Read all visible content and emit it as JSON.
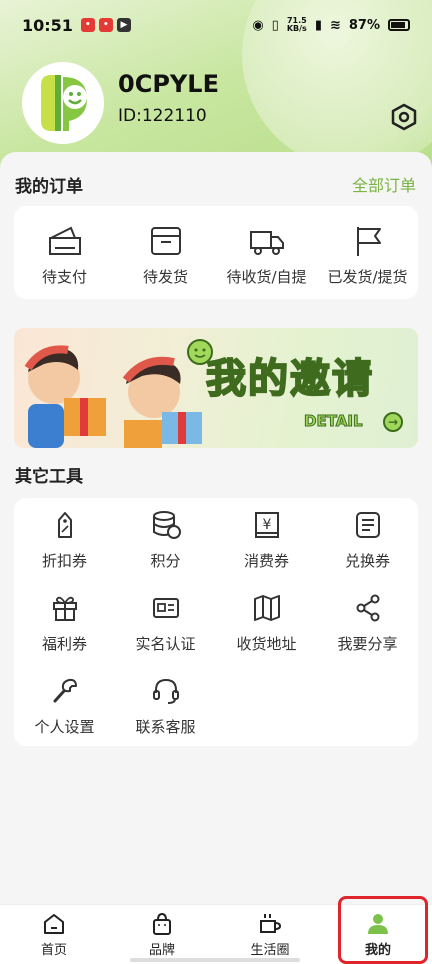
{
  "status_bar": {
    "time": "10:51",
    "net_speed_value": "71.5",
    "net_speed_unit": "KB/s",
    "battery": "87%"
  },
  "profile": {
    "username": "0CPYLE",
    "user_id": "ID:122110"
  },
  "orders": {
    "title": "我的订单",
    "all_orders_link": "全部订单",
    "items": [
      {
        "label": "待支付",
        "icon": "payment-pending-icon"
      },
      {
        "label": "待发货",
        "icon": "box-icon"
      },
      {
        "label": "待收货/自提",
        "icon": "truck-icon"
      },
      {
        "label": "已发货/提货",
        "icon": "flag-icon"
      }
    ]
  },
  "banner": {
    "title": "我的邀请",
    "detail_label": "DETAIL"
  },
  "tools": {
    "title": "其它工具",
    "items": [
      {
        "label": "折扣券",
        "icon": "discount-tag-icon"
      },
      {
        "label": "积分",
        "icon": "coins-icon"
      },
      {
        "label": "消费券",
        "icon": "yuan-voucher-icon"
      },
      {
        "label": "兑换券",
        "icon": "exchange-ticket-icon"
      },
      {
        "label": "福利券",
        "icon": "gift-icon"
      },
      {
        "label": "实名认证",
        "icon": "id-card-icon"
      },
      {
        "label": "收货地址",
        "icon": "map-icon"
      },
      {
        "label": "我要分享",
        "icon": "share-icon"
      },
      {
        "label": "个人设置",
        "icon": "wrench-icon"
      },
      {
        "label": "联系客服",
        "icon": "headset-icon"
      }
    ]
  },
  "bottom_nav": {
    "items": [
      {
        "label": "首页",
        "icon": "home-icon"
      },
      {
        "label": "品牌",
        "icon": "bag-icon"
      },
      {
        "label": "生活圈",
        "icon": "cup-icon"
      },
      {
        "label": "我的",
        "icon": "user-icon"
      }
    ],
    "active_index": 3
  },
  "colors": {
    "accent": "#7bb445",
    "active_nav": "#7cc24a",
    "highlight_border": "#e0242b"
  }
}
